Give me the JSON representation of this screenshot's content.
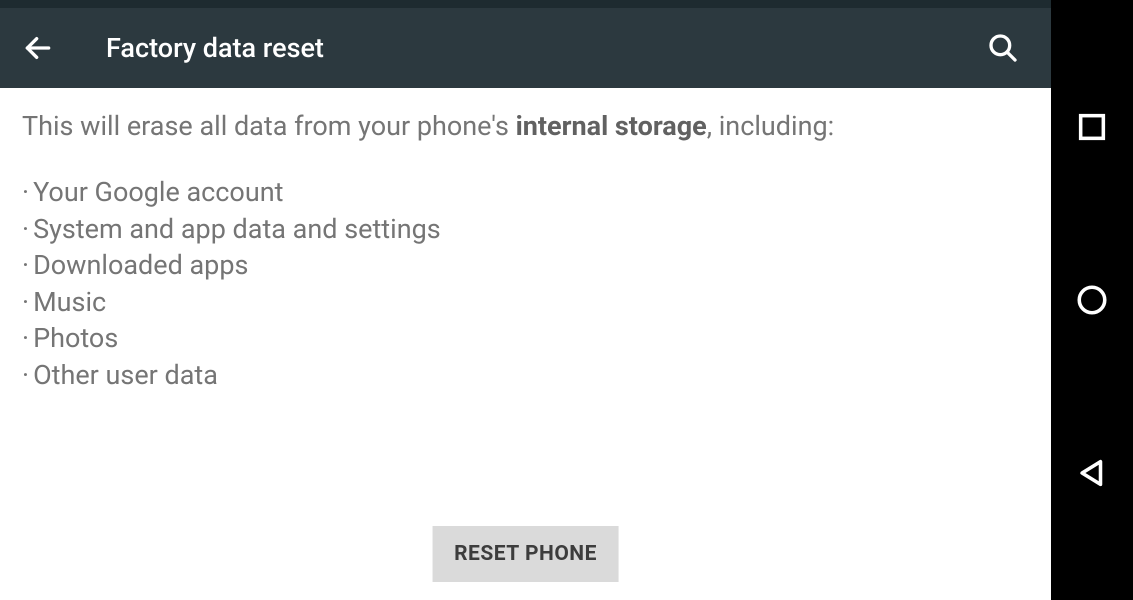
{
  "header": {
    "title": "Factory data reset"
  },
  "content": {
    "description_pre": "This will erase all data from your phone's ",
    "description_bold": "internal storage",
    "description_post": ", including:",
    "items": [
      "Your Google account",
      "System and app data and settings",
      "Downloaded apps",
      "Music",
      "Photos",
      "Other user data"
    ]
  },
  "actions": {
    "reset_button_label": "RESET PHONE"
  },
  "icons": {
    "back": "back-arrow",
    "search": "search",
    "nav_recent": "square",
    "nav_home": "circle",
    "nav_back": "triangle"
  }
}
